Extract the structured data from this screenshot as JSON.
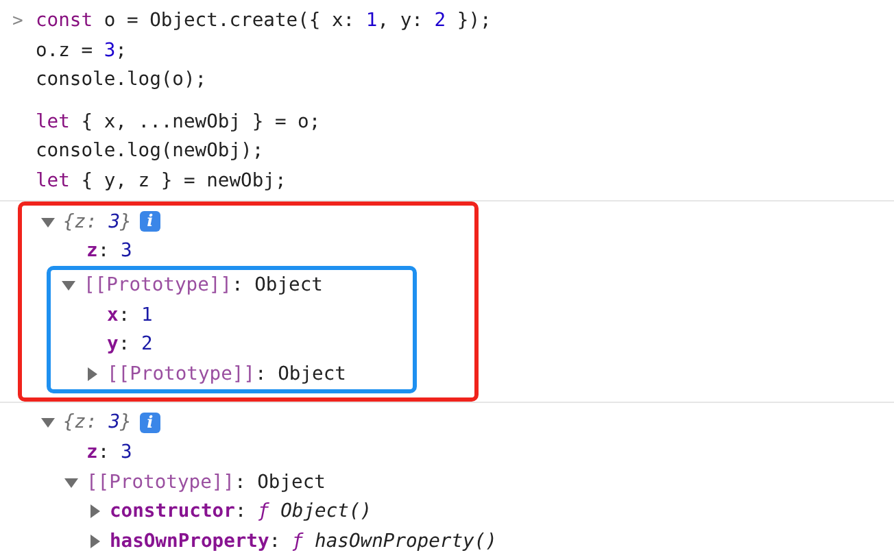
{
  "input": {
    "prompt": ">",
    "lines": [
      {
        "kind": "code",
        "tokens": [
          {
            "text": "const",
            "kind": "keyword"
          },
          {
            "text": " o = Object.create({ x: ",
            "kind": "plain"
          },
          {
            "text": "1",
            "kind": "number"
          },
          {
            "text": ", y: ",
            "kind": "plain"
          },
          {
            "text": "2",
            "kind": "number"
          },
          {
            "text": " });",
            "kind": "plain"
          }
        ]
      },
      {
        "kind": "code",
        "tokens": [
          {
            "text": "o.z = ",
            "kind": "plain"
          },
          {
            "text": "3",
            "kind": "number"
          },
          {
            "text": ";",
            "kind": "plain"
          }
        ]
      },
      {
        "kind": "code",
        "tokens": [
          {
            "text": "console.log(o);",
            "kind": "plain"
          }
        ]
      },
      {
        "kind": "blank"
      },
      {
        "kind": "code",
        "tokens": [
          {
            "text": "let",
            "kind": "keyword"
          },
          {
            "text": " { x, ...newObj } = o;",
            "kind": "plain"
          }
        ]
      },
      {
        "kind": "code",
        "tokens": [
          {
            "text": "console.log(newObj);",
            "kind": "plain"
          }
        ]
      },
      {
        "kind": "code",
        "tokens": [
          {
            "text": "let",
            "kind": "keyword"
          },
          {
            "text": " { y, z } = newObj;",
            "kind": "plain"
          }
        ]
      }
    ]
  },
  "outputs": [
    {
      "frame": {
        "color": "#f0231c"
      },
      "tree": {
        "kind": "summary",
        "open": "{",
        "key": "z",
        "sep": ":",
        "value": "3",
        "close": "}",
        "badge": "i",
        "expanded": true,
        "children": [
          {
            "kind": "prop",
            "key": "z",
            "sep": ":",
            "value": "3"
          },
          {
            "kind": "proto",
            "key": "[[Prototype]]",
            "sep": ":",
            "value": "Object",
            "expanded": true,
            "frame": {
              "color": "#1e90f0"
            },
            "children": [
              {
                "kind": "prop",
                "key": "x",
                "sep": ":",
                "value": "1"
              },
              {
                "kind": "prop",
                "key": "y",
                "sep": ":",
                "value": "2"
              },
              {
                "kind": "proto",
                "key": "[[Prototype]]",
                "sep": ":",
                "value": "Object",
                "expanded": false
              }
            ]
          }
        ]
      }
    },
    {
      "tree": {
        "kind": "summary",
        "open": "{",
        "key": "z",
        "sep": ":",
        "value": "3",
        "close": "}",
        "badge": "i",
        "expanded": true,
        "children": [
          {
            "kind": "prop",
            "key": "z",
            "sep": ":",
            "value": "3"
          },
          {
            "kind": "proto",
            "key": "[[Prototype]]",
            "sep": ":",
            "value": "Object",
            "expanded": true,
            "children": [
              {
                "kind": "method",
                "key": "constructor",
                "sep": ":",
                "sign": "ƒ",
                "value": "Object()",
                "expanded": false
              },
              {
                "kind": "method",
                "key": "hasOwnProperty",
                "sep": ":",
                "sign": "ƒ",
                "value": "hasOwnProperty()",
                "expanded": false
              }
            ]
          }
        ]
      }
    }
  ]
}
